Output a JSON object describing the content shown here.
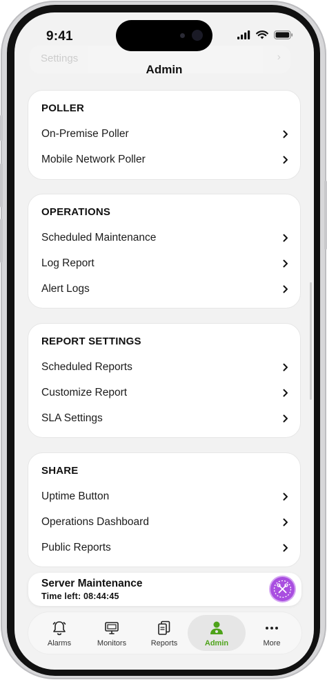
{
  "status_bar": {
    "time": "9:41"
  },
  "background_row": {
    "label": "Settings",
    "chevron": "›"
  },
  "header": {
    "title": "Admin"
  },
  "sections": [
    {
      "title": "POLLER",
      "items": [
        "On-Premise Poller",
        "Mobile Network Poller"
      ]
    },
    {
      "title": "OPERATIONS",
      "items": [
        "Scheduled Maintenance",
        "Log Report",
        "Alert Logs"
      ]
    },
    {
      "title": "REPORT SETTINGS",
      "items": [
        "Scheduled Reports",
        "Customize Report",
        "SLA Settings"
      ]
    },
    {
      "title": "SHARE",
      "items": [
        "Uptime Button",
        "Operations Dashboard",
        "Public Reports"
      ]
    }
  ],
  "maintenance_banner": {
    "title": "Server Maintenance",
    "time_left": "Time left: 08:44:45",
    "icon": "maintenance-tools-icon",
    "color": "#a94ee0"
  },
  "tabbar": {
    "active_color": "#4ea31a",
    "tabs": [
      {
        "label": "Alarms",
        "icon": "bell-icon"
      },
      {
        "label": "Monitors",
        "icon": "monitor-icon"
      },
      {
        "label": "Reports",
        "icon": "reports-icon"
      },
      {
        "label": "Admin",
        "icon": "admin-user-icon",
        "active": true
      },
      {
        "label": "More",
        "icon": "more-dots-icon"
      }
    ]
  }
}
